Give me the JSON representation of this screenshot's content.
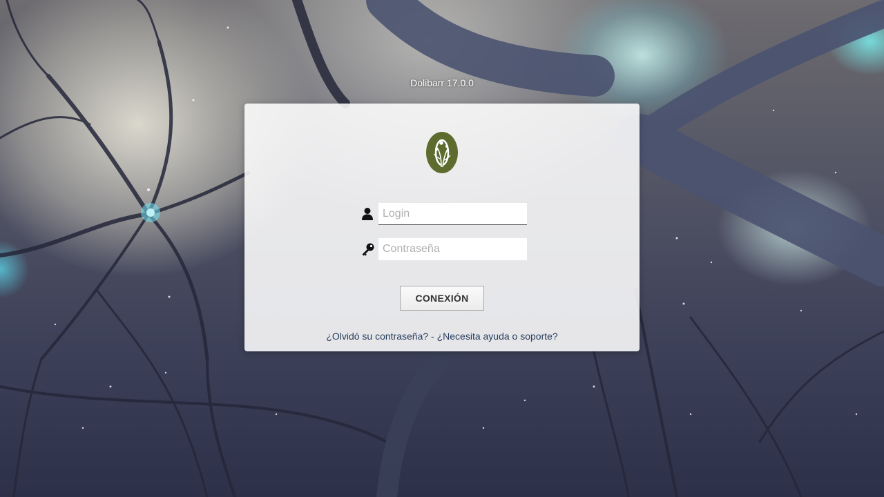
{
  "app": {
    "version_text": "Dolibarr 17.0.0"
  },
  "login_form": {
    "logo_icon": "olive-leaf-logo",
    "login_field": {
      "icon": "user-icon",
      "value": "",
      "placeholder": "Login"
    },
    "password_field": {
      "icon": "key-icon",
      "value": "",
      "placeholder": "Contraseña"
    },
    "submit_label": "CONEXIÓN"
  },
  "footer_links": {
    "forgot_password": "¿Olvidó su contraseña?",
    "separator": "-",
    "help_support": "¿Necesita ayuda o soporte?"
  },
  "colors": {
    "logo_green": "#5d6b2e",
    "link_color": "#263c5c"
  }
}
